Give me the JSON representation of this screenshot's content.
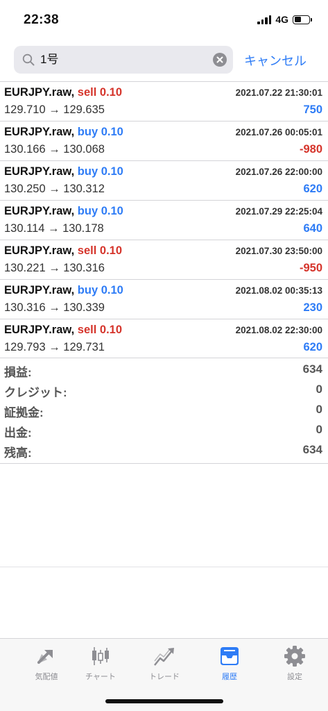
{
  "status_bar": {
    "time": "22:38",
    "network": "4G"
  },
  "search": {
    "query": "1号",
    "cancel_label": "キャンセル"
  },
  "trades": [
    {
      "symbol": "EURJPY.raw,",
      "side": "sell",
      "lots": "0.10",
      "datetime": "2021.07.22 21:30:01",
      "prices": "129.710 → 129.635",
      "profit": "750"
    },
    {
      "symbol": "EURJPY.raw,",
      "side": "buy",
      "lots": "0.10",
      "datetime": "2021.07.26 00:05:01",
      "prices": "130.166 → 130.068",
      "profit": "-980"
    },
    {
      "symbol": "EURJPY.raw,",
      "side": "buy",
      "lots": "0.10",
      "datetime": "2021.07.26 22:00:00",
      "prices": "130.250 → 130.312",
      "profit": "620"
    },
    {
      "symbol": "EURJPY.raw,",
      "side": "buy",
      "lots": "0.10",
      "datetime": "2021.07.29 22:25:04",
      "prices": "130.114 → 130.178",
      "profit": "640"
    },
    {
      "symbol": "EURJPY.raw,",
      "side": "sell",
      "lots": "0.10",
      "datetime": "2021.07.30 23:50:00",
      "prices": "130.221 → 130.316",
      "profit": "-950"
    },
    {
      "symbol": "EURJPY.raw,",
      "side": "buy",
      "lots": "0.10",
      "datetime": "2021.08.02 00:35:13",
      "prices": "130.316 → 130.339",
      "profit": "230"
    },
    {
      "symbol": "EURJPY.raw,",
      "side": "sell",
      "lots": "0.10",
      "datetime": "2021.08.02 22:30:00",
      "prices": "129.793 → 129.731",
      "profit": "620"
    }
  ],
  "summary": [
    {
      "label": "損益:",
      "value": "634"
    },
    {
      "label": "クレジット:",
      "value": "0"
    },
    {
      "label": "証拠金:",
      "value": "0"
    },
    {
      "label": "出金:",
      "value": "0"
    },
    {
      "label": "残高:",
      "value": "634"
    }
  ],
  "tabs": [
    {
      "label": "気配値",
      "icon": "quotes-icon",
      "active": false
    },
    {
      "label": "チャート",
      "icon": "chart-icon",
      "active": false
    },
    {
      "label": "トレード",
      "icon": "trade-icon",
      "active": false
    },
    {
      "label": "履歴",
      "icon": "history-icon",
      "active": true
    },
    {
      "label": "設定",
      "icon": "settings-icon",
      "active": false
    }
  ],
  "colors": {
    "accent": "#2e7cf6",
    "sell": "#d5342b",
    "buy": "#2e7cf6",
    "negative": "#d5342b",
    "positive": "#2e7cf6"
  }
}
